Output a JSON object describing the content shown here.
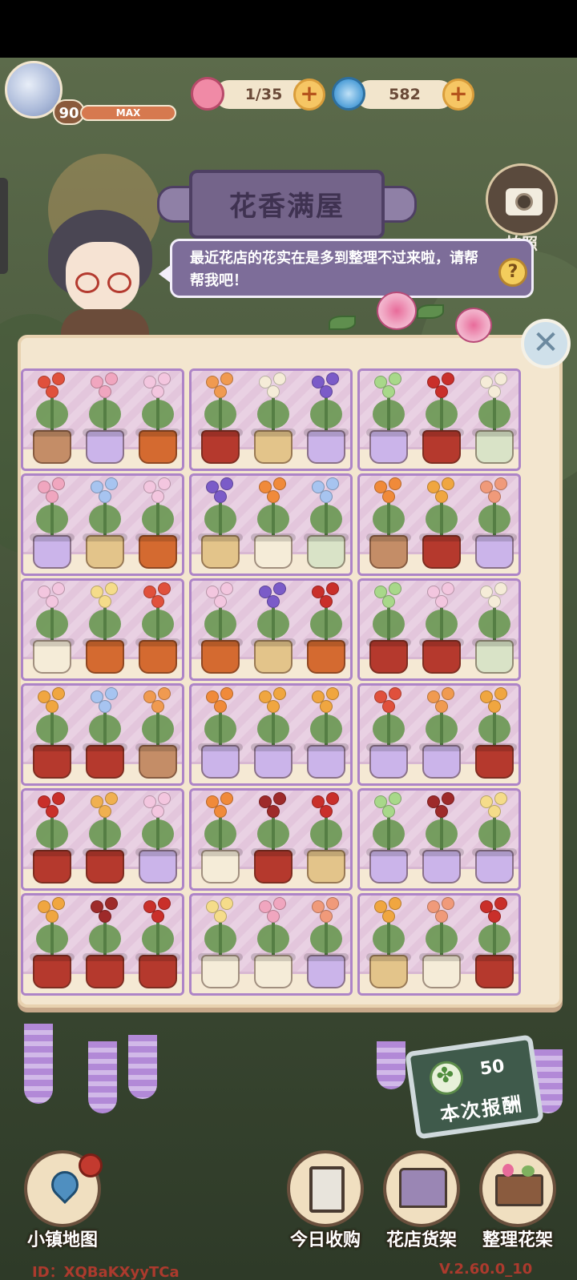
{
  "hud": {
    "level": "90",
    "xp_label": "MAX",
    "flower_currency": "1/35",
    "swirl_currency": "582",
    "plus": "+",
    "camera_label": "拍照"
  },
  "title": "花香满屋",
  "speech": "最近花店的花实在是多到整理不过来啦，请帮帮我吧！",
  "help": "?",
  "close": "✕",
  "reward": {
    "value": "50",
    "label": "本次报酬"
  },
  "nav": {
    "map": "小镇地图",
    "daily": "今日收购",
    "shop": "花店货架",
    "organize": "整理花架"
  },
  "footer": {
    "id": "ID：XQBaKXyyTCa",
    "version": "V.2.60.0_10"
  },
  "colors": {
    "panel": "#f3e6cf",
    "shelf_border": "#ad84c7",
    "accent": "#7d6d99"
  },
  "shelves": [
    [
      {
        "f": "#e0503c",
        "p": "#c48d67"
      },
      {
        "f": "#f0a6bf",
        "p": "#cbb4ea"
      },
      {
        "f": "#f3c6df",
        "p": "#d46a30"
      }
    ],
    [
      {
        "f": "#f09a50",
        "p": "#b5392d"
      },
      {
        "f": "#f5ecd8",
        "p": "#e3c48a"
      },
      {
        "f": "#7b5bc8",
        "p": "#cbb4ea"
      }
    ],
    [
      {
        "f": "#a8d88a",
        "p": "#cbb4ea"
      },
      {
        "f": "#c92f2a",
        "p": "#b5392d"
      },
      {
        "f": "#f5ecd8",
        "p": "#d9e3c7"
      }
    ],
    [
      {
        "f": "#f0a6bf",
        "p": "#cbb4ea"
      },
      {
        "f": "#a7c4f0",
        "p": "#e3c48a"
      },
      {
        "f": "#f3c6df",
        "p": "#d46a30"
      }
    ],
    [
      {
        "f": "#7b5bc8",
        "p": "#e3c48a"
      },
      {
        "f": "#f08a3a",
        "p": "#f5ecd8"
      },
      {
        "f": "#a7c4f0",
        "p": "#d9e3c7"
      }
    ],
    [
      {
        "f": "#f08a3a",
        "p": "#c48d67"
      },
      {
        "f": "#f0a640",
        "p": "#b5392d"
      },
      {
        "f": "#f09a7a",
        "p": "#cbb4ea"
      }
    ],
    [
      {
        "f": "#f3c6df",
        "p": "#f5ecd8"
      },
      {
        "f": "#f5dc8a",
        "p": "#d46a30"
      },
      {
        "f": "#e0503c",
        "p": "#d46a30"
      }
    ],
    [
      {
        "f": "#f3c6df",
        "p": "#d46a30"
      },
      {
        "f": "#7b5bc8",
        "p": "#e3c48a"
      },
      {
        "f": "#c92f2a",
        "p": "#d46a30"
      }
    ],
    [
      {
        "f": "#a8d88a",
        "p": "#b5392d"
      },
      {
        "f": "#f3c6df",
        "p": "#b5392d"
      },
      {
        "f": "#f5ecd8",
        "p": "#d9e3c7"
      }
    ],
    [
      {
        "f": "#f0a640",
        "p": "#b5392d"
      },
      {
        "f": "#a7c4f0",
        "p": "#b5392d"
      },
      {
        "f": "#f09a50",
        "p": "#c48d67"
      }
    ],
    [
      {
        "f": "#f08a3a",
        "p": "#cbb4ea"
      },
      {
        "f": "#f0a640",
        "p": "#cbb4ea"
      },
      {
        "f": "#f0a640",
        "p": "#cbb4ea"
      }
    ],
    [
      {
        "f": "#e0503c",
        "p": "#cbb4ea"
      },
      {
        "f": "#f09a50",
        "p": "#cbb4ea"
      },
      {
        "f": "#f0a640",
        "p": "#b5392d"
      }
    ],
    [
      {
        "f": "#c92f2a",
        "p": "#b5392d"
      },
      {
        "f": "#f0b050",
        "p": "#b5392d"
      },
      {
        "f": "#f3c6df",
        "p": "#cbb4ea"
      }
    ],
    [
      {
        "f": "#f08a3a",
        "p": "#f5ecd8"
      },
      {
        "f": "#9e2a2a",
        "p": "#b5392d"
      },
      {
        "f": "#c92f2a",
        "p": "#e3c48a"
      }
    ],
    [
      {
        "f": "#a8d88a",
        "p": "#cbb4ea"
      },
      {
        "f": "#9e2a2a",
        "p": "#cbb4ea"
      },
      {
        "f": "#f5dc8a",
        "p": "#cbb4ea"
      }
    ],
    [
      {
        "f": "#f0a640",
        "p": "#b5392d"
      },
      {
        "f": "#9e2a2a",
        "p": "#b5392d"
      },
      {
        "f": "#c92f2a",
        "p": "#b5392d"
      }
    ],
    [
      {
        "f": "#f5dc8a",
        "p": "#f5ecd8"
      },
      {
        "f": "#f0a6bf",
        "p": "#f5ecd8"
      },
      {
        "f": "#f09a7a",
        "p": "#cbb4ea"
      }
    ],
    [
      {
        "f": "#f0a640",
        "p": "#e3c48a"
      },
      {
        "f": "#f09a7a",
        "p": "#f5ecd8"
      },
      {
        "f": "#c92f2a",
        "p": "#b5392d"
      }
    ]
  ]
}
